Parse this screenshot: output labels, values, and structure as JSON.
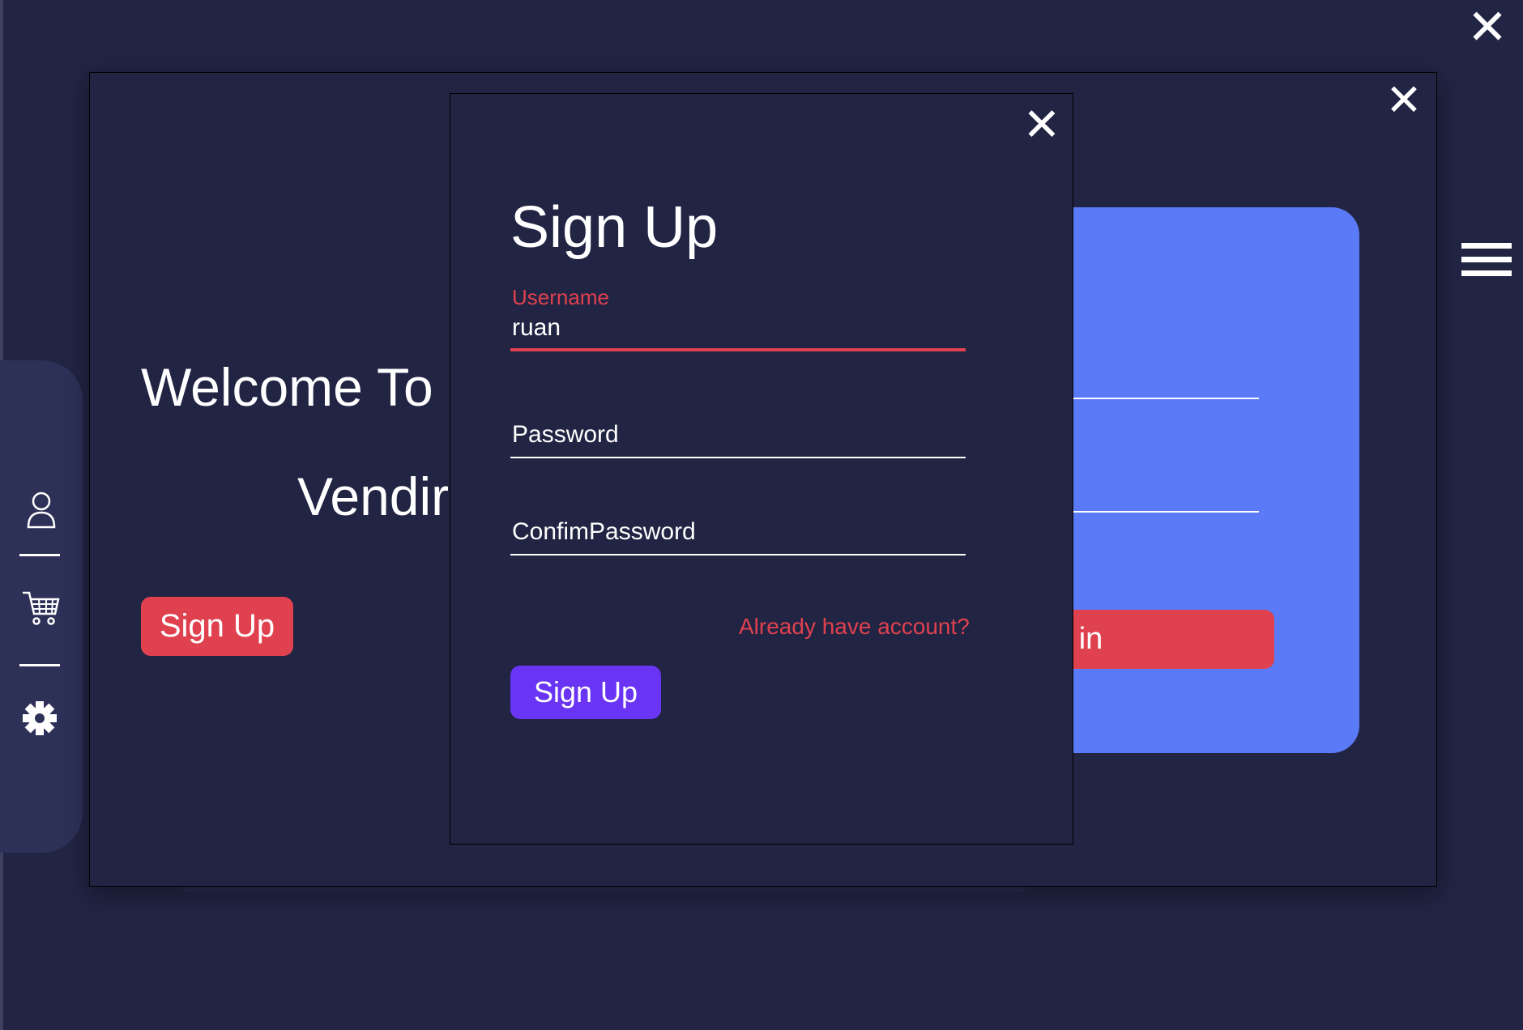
{
  "window": {
    "close_glyph": "✕",
    "menu_icon": "hamburger-icon"
  },
  "landing": {
    "welcome_line1": "Welcome To",
    "welcome_line2": "Vendir",
    "signup_button": "Sign Up",
    "close_glyph": "✕"
  },
  "login_card": {
    "button_label": "g in"
  },
  "sidebar": {
    "items": [
      {
        "icon": "user-icon"
      },
      {
        "icon": "cart-icon"
      },
      {
        "icon": "gear-icon"
      }
    ]
  },
  "signup_modal": {
    "close_glyph": "✕",
    "title": "Sign Up",
    "username_label": "Username",
    "username_value": "ruan",
    "password_placeholder": "Password",
    "confirm_placeholder": "ConfimPassword",
    "already_link": "Already have account?",
    "submit_label": "Sign Up"
  },
  "colors": {
    "background": "#212443",
    "accent_red": "#e0414f",
    "accent_purple": "#6a34f4",
    "card_blue": "#5a7af8"
  }
}
